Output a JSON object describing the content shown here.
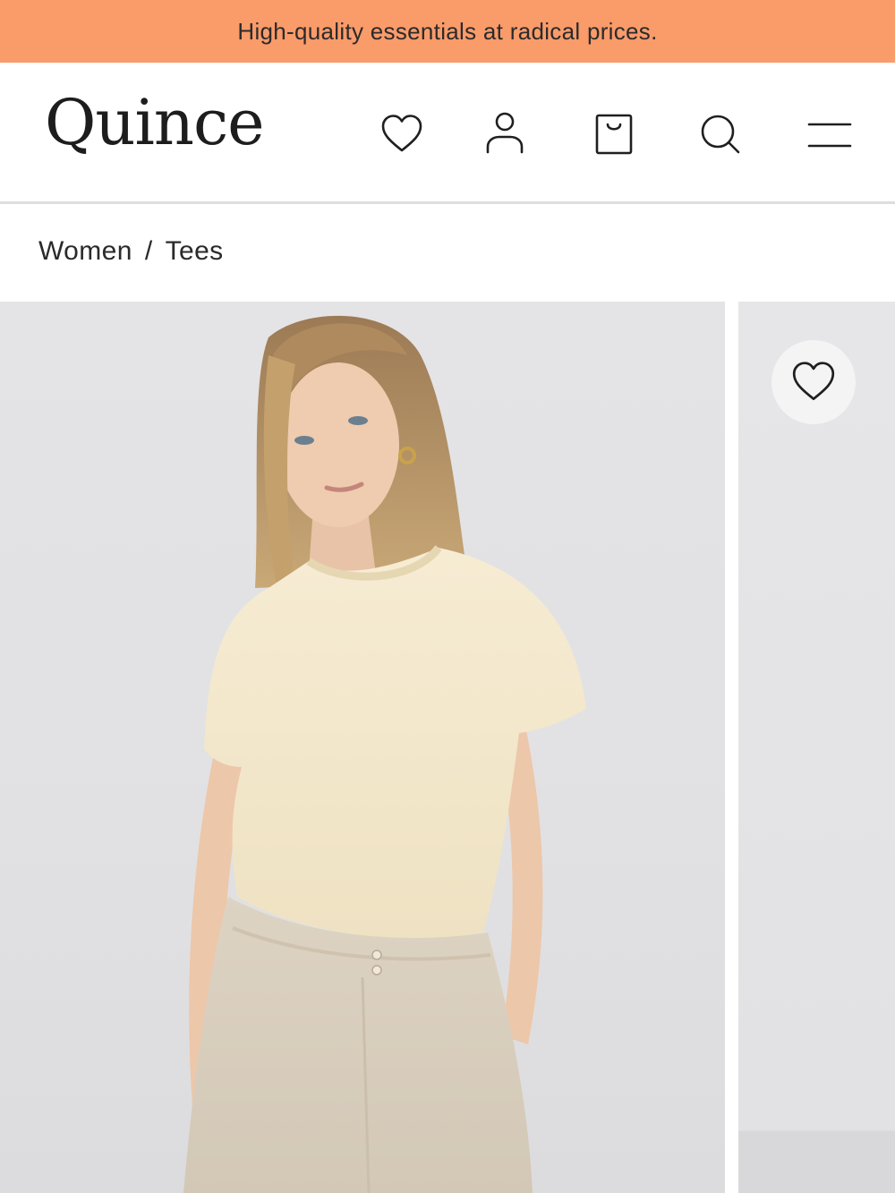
{
  "promo": {
    "text": "High-quality essentials at radical prices.",
    "background": "#FA9B6A"
  },
  "header": {
    "logo": "Quince",
    "icons": [
      "heart-icon",
      "user-icon",
      "shopping-bag-icon",
      "search-icon",
      "menu-icon"
    ]
  },
  "breadcrumb": {
    "items": [
      "Women",
      "Tees"
    ],
    "separator": "/"
  },
  "gallery": {
    "images": [
      {
        "description": "model-wearing-cream-short-sleeve-sweater-tee"
      },
      {
        "description": "next-product-image"
      }
    ],
    "favorite_icon": "heart-icon"
  }
}
